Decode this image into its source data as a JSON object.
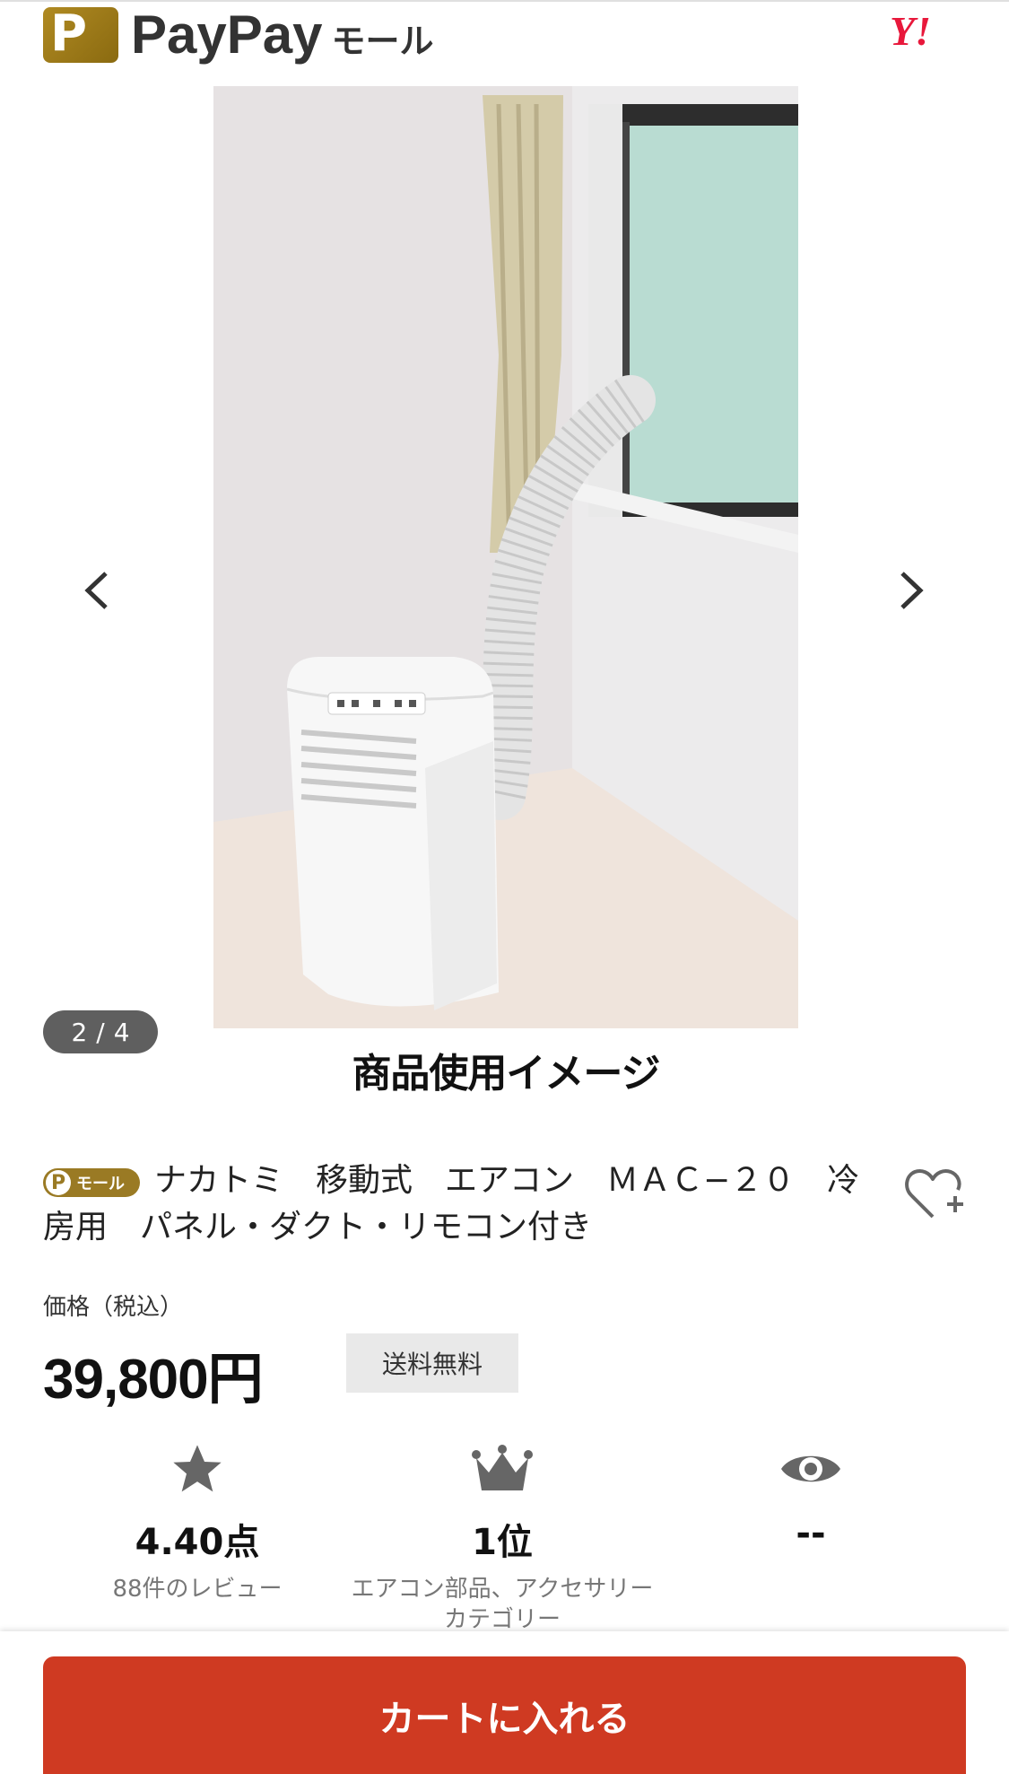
{
  "header": {
    "logo_letter": "P",
    "brand": "PayPay",
    "brand_suffix": "モール",
    "yahoo": "Y!"
  },
  "gallery": {
    "current": "2",
    "separator": "/",
    "total": "4",
    "caption": "商品使用イメージ"
  },
  "product": {
    "badge_letter": "P",
    "badge_text": "モール",
    "title": "ナカトミ　移動式　エアコン　ＭＡＣ−２０　冷房用　パネル・ダクト・リモコン付き",
    "price_label": "価格（税込）",
    "price": "39,800円",
    "shipping": "送料無料"
  },
  "stats": {
    "rating_value": "4.40点",
    "rating_sub": "88件のレビュー",
    "rank_value": "1位",
    "rank_sub": "エアコン部品、アクセサリーカテゴリー",
    "views_value": "--"
  },
  "cart": {
    "label": "カートに入れる"
  },
  "colors": {
    "accent": "#cf3a22",
    "gold": "#9a7a24",
    "yahoo_red": "#e8183b"
  },
  "icons": [
    "chevron-left-icon",
    "chevron-right-icon",
    "heart-plus-icon",
    "star-icon",
    "crown-icon",
    "eye-icon"
  ]
}
